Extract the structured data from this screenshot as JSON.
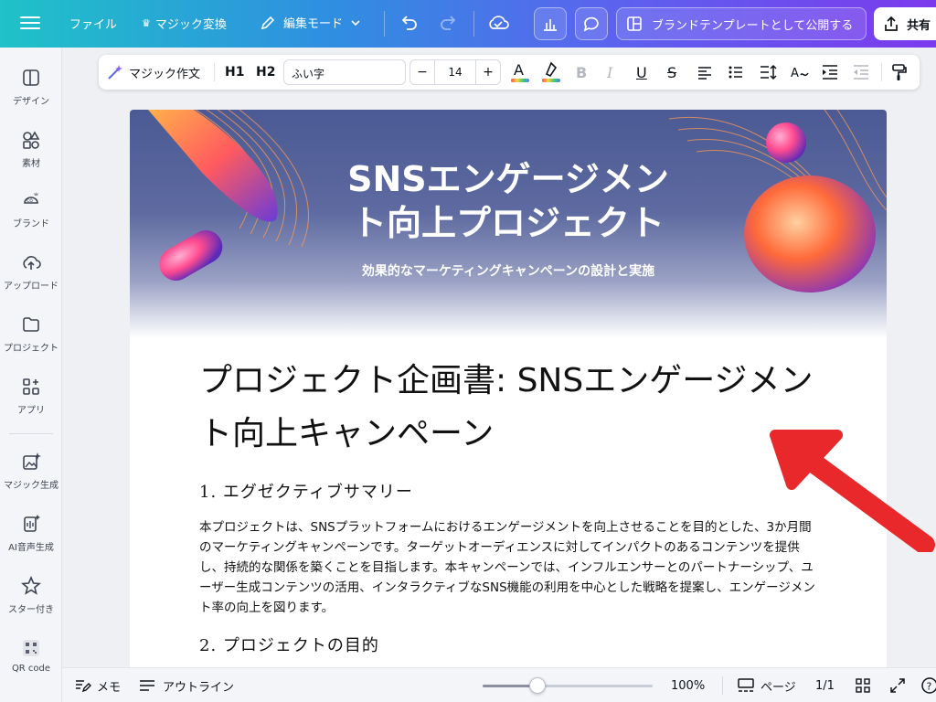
{
  "topbar": {
    "file_label": "ファイル",
    "magic_switch_label": "マジック変換",
    "edit_mode_label": "編集モード",
    "publish_brand_label": "ブランドテンプレートとして公開する",
    "share_label": "共有"
  },
  "sidebar": {
    "items": [
      {
        "label": "デザイン",
        "icon": "layout-icon"
      },
      {
        "label": "素材",
        "icon": "elements-icon"
      },
      {
        "label": "ブランド",
        "icon": "brand-icon"
      },
      {
        "label": "アップロード",
        "icon": "upload-icon"
      },
      {
        "label": "プロジェクト",
        "icon": "folder-icon"
      },
      {
        "label": "アプリ",
        "icon": "apps-icon"
      },
      {
        "label": "マジック生成",
        "icon": "magic-media-icon"
      },
      {
        "label": "AI音声生成",
        "icon": "ai-voice-icon"
      },
      {
        "label": "スター付き",
        "icon": "star-icon"
      },
      {
        "label": "QR code",
        "icon": "qr-code-icon"
      }
    ]
  },
  "format_toolbar": {
    "magic_write_label": "マジック作文",
    "h1_label": "H1",
    "h2_label": "H2",
    "font_name": "ふい字",
    "font_size": "14",
    "minus": "−",
    "plus": "+"
  },
  "document": {
    "banner_title_line1": "SNSエンゲージメン",
    "banner_title_line2": "ト向上プロジェクト",
    "banner_subtitle": "効果的なマーケティングキャンペーンの設計と実施",
    "title": "プロジェクト企画書: SNSエンゲージメント向上キャンペーン",
    "section1_heading": "1. エグゼクティブサマリー",
    "section1_body": "本プロジェクトは、SNSプラットフォームにおけるエンゲージメントを向上させることを目的とした、3か月間のマーケティングキャンペーンです。ターゲットオーディエンスに対してインパクトのあるコンテンツを提供し、持続的な関係を築くことを目指します。本キャンペーンでは、インフルエンサーとのパートナーシップ、ユーザー生成コンテンツの活用、インタラクティブなSNS機能の利用を中心とした戦略を提案し、エンゲージメント率の向上を図ります。",
    "section2_heading": "2. プロジェクトの目的"
  },
  "bottombar": {
    "notes_label": "メモ",
    "outline_label": "アウトライン",
    "zoom_level": "100%",
    "zoom_fraction": 0.32,
    "pages_label": "ページ",
    "page_count": "1/1"
  },
  "colors": {
    "accent_gradient_start": "#1fc2c8",
    "accent_gradient_end": "#7c3aed",
    "annotation_arrow": "#e8282a"
  }
}
